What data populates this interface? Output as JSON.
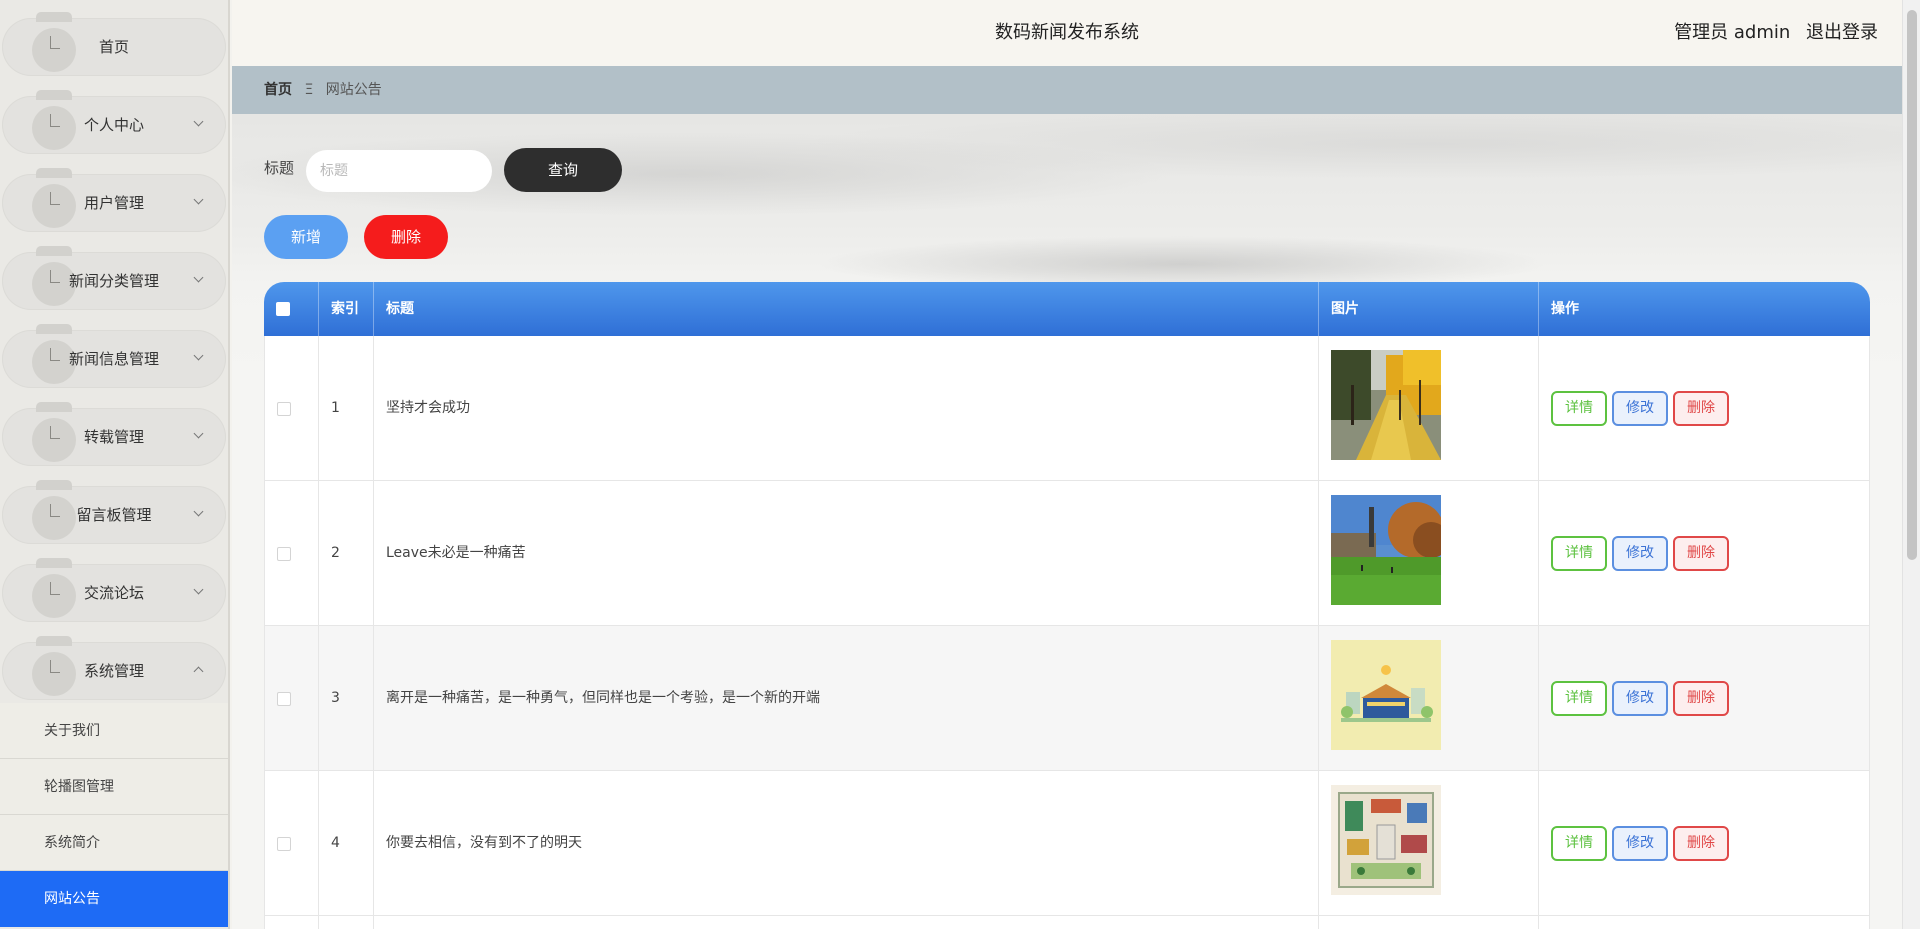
{
  "header": {
    "title": "数码新闻发布系统",
    "user_label": "管理员 admin",
    "logout": "退出登录"
  },
  "sidebar": {
    "items": [
      {
        "label": "首页",
        "expandable": false,
        "expanded": false
      },
      {
        "label": "个人中心",
        "expandable": true,
        "expanded": false
      },
      {
        "label": "用户管理",
        "expandable": true,
        "expanded": false
      },
      {
        "label": "新闻分类管理",
        "expandable": true,
        "expanded": false
      },
      {
        "label": "新闻信息管理",
        "expandable": true,
        "expanded": false
      },
      {
        "label": "转载管理",
        "expandable": true,
        "expanded": false
      },
      {
        "label": "留言板管理",
        "expandable": true,
        "expanded": false
      },
      {
        "label": "交流论坛",
        "expandable": true,
        "expanded": false
      },
      {
        "label": "系统管理",
        "expandable": true,
        "expanded": true
      }
    ],
    "submenu": [
      {
        "label": "关于我们",
        "active": false
      },
      {
        "label": "轮播图管理",
        "active": false
      },
      {
        "label": "系统简介",
        "active": false
      },
      {
        "label": "网站公告",
        "active": true
      }
    ]
  },
  "breadcrumb": {
    "home": "首页",
    "separator": "Ξ",
    "current": "网站公告"
  },
  "search": {
    "label": "标题",
    "placeholder": "标题",
    "value": "",
    "button": "查询"
  },
  "actions": {
    "add": "新增",
    "delete": "删除"
  },
  "table": {
    "columns": [
      "",
      "索引",
      "标题",
      "图片",
      "操作"
    ],
    "rows": [
      {
        "index": "1",
        "title": "坚持才会成功"
      },
      {
        "index": "2",
        "title": "Leave未必是一种痛苦"
      },
      {
        "index": "3",
        "title": "离开是一种痛苦，是一种勇气，但同样也是一个考验，是一个新的开端"
      },
      {
        "index": "4",
        "title": "你要去相信，没有到不了的明天"
      }
    ],
    "op_labels": {
      "detail": "详情",
      "edit": "修改",
      "delete": "删除"
    }
  },
  "colors": {
    "accent": "#1e6bf5",
    "table_header": "#3d85e3",
    "danger": "#f51c1c",
    "add_button": "#5ba0f2",
    "query_button": "#2e2e2e",
    "detail": "#5dc240"
  }
}
